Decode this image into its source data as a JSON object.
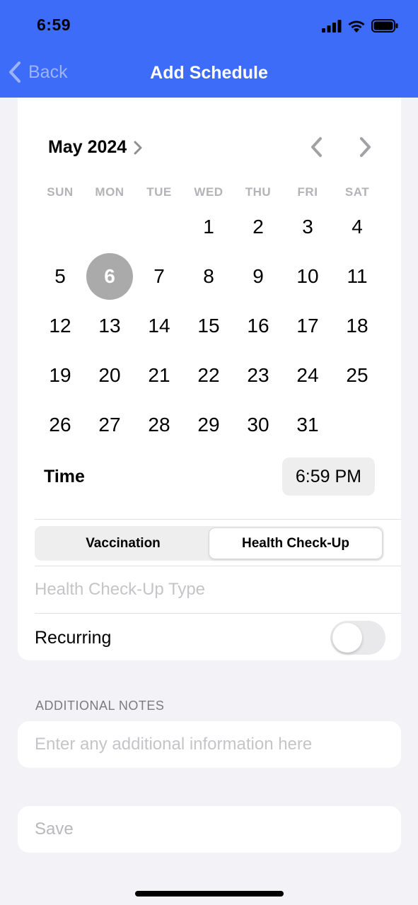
{
  "status_bar": {
    "time": "6:59"
  },
  "nav": {
    "back_label": "Back",
    "title": "Add Schedule"
  },
  "calendar": {
    "month_label": "May 2024",
    "weekdays": [
      "SUN",
      "MON",
      "TUE",
      "WED",
      "THU",
      "FRI",
      "SAT"
    ],
    "days": [
      "1",
      "2",
      "3",
      "4",
      "5",
      "6",
      "7",
      "8",
      "9",
      "10",
      "11",
      "12",
      "13",
      "14",
      "15",
      "16",
      "17",
      "18",
      "19",
      "20",
      "21",
      "22",
      "23",
      "24",
      "25",
      "26",
      "27",
      "28",
      "29",
      "30",
      "31"
    ],
    "selected_day": "6"
  },
  "time": {
    "label": "Time",
    "value": "6:59 PM"
  },
  "segment": {
    "options": [
      "Vaccination",
      "Health Check-Up"
    ],
    "selected": "Health Check-Up"
  },
  "checkup_type": {
    "placeholder": "Health Check-Up Type"
  },
  "recurring": {
    "label": "Recurring",
    "on": false
  },
  "notes": {
    "header": "ADDITIONAL NOTES",
    "placeholder": "Enter any additional information here"
  },
  "save": {
    "label": "Save"
  },
  "colors": {
    "nav_bar": "#3d6cf8",
    "selected_day": "#aaaaaa",
    "background": "#f2f2f7"
  },
  "icons": {
    "back": "chevron-left-icon",
    "month_next": "chevron-right-icon",
    "prev_month": "chevron-left-icon",
    "next_month": "chevron-right-icon",
    "signal": "cellular-signal-icon",
    "wifi": "wifi-icon",
    "battery": "battery-icon"
  }
}
